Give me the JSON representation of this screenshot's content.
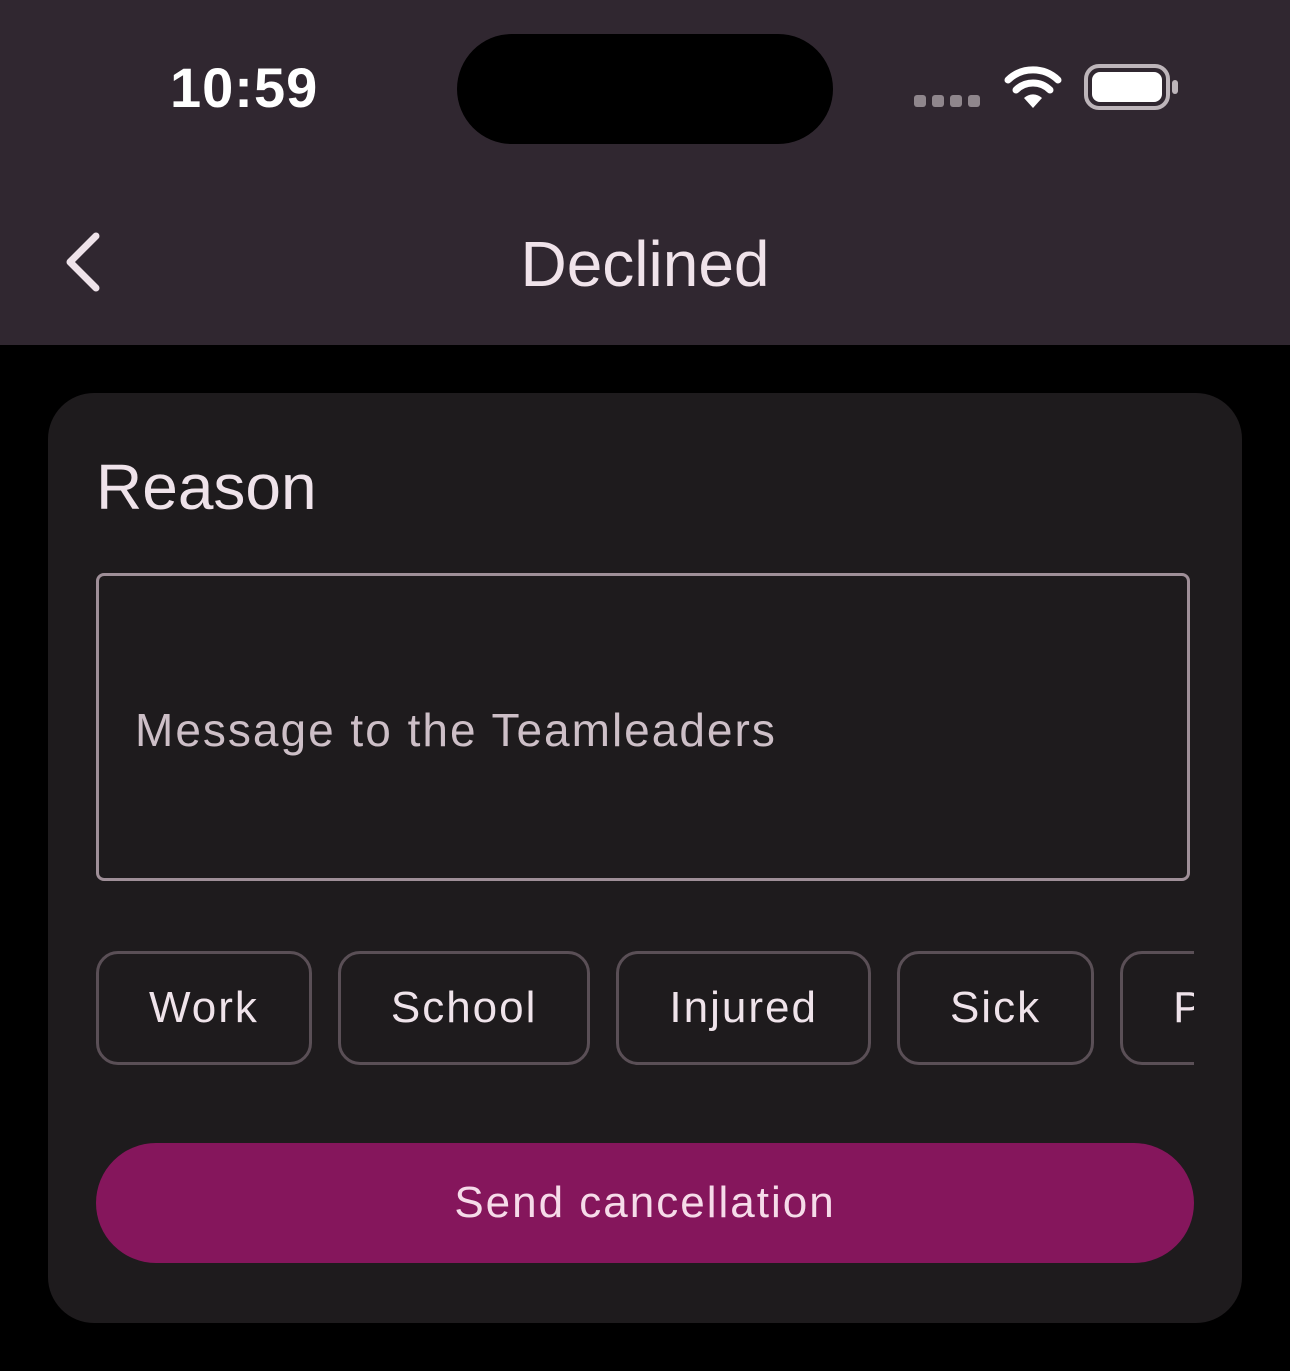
{
  "status_bar": {
    "time": "10:59",
    "signal_icon": "signal-dots-icon",
    "wifi_icon": "wifi-icon",
    "battery_icon": "battery-icon"
  },
  "nav": {
    "back_icon": "chevron-left-icon",
    "title": "Declined"
  },
  "card": {
    "title": "Reason",
    "message_placeholder": "Message to the Teamleaders",
    "message_value": "",
    "chips": [
      {
        "label": "Work"
      },
      {
        "label": "School"
      },
      {
        "label": "Injured"
      },
      {
        "label": "Sick"
      },
      {
        "label": "Private"
      }
    ],
    "send_label": "Send cancellation"
  },
  "colors": {
    "topbar_bg": "#302730",
    "page_bg": "#000000",
    "card_bg": "#1e1b1d",
    "accent": "#85165c",
    "text_primary": "#efe3ea",
    "outline": "#9f8f98"
  }
}
